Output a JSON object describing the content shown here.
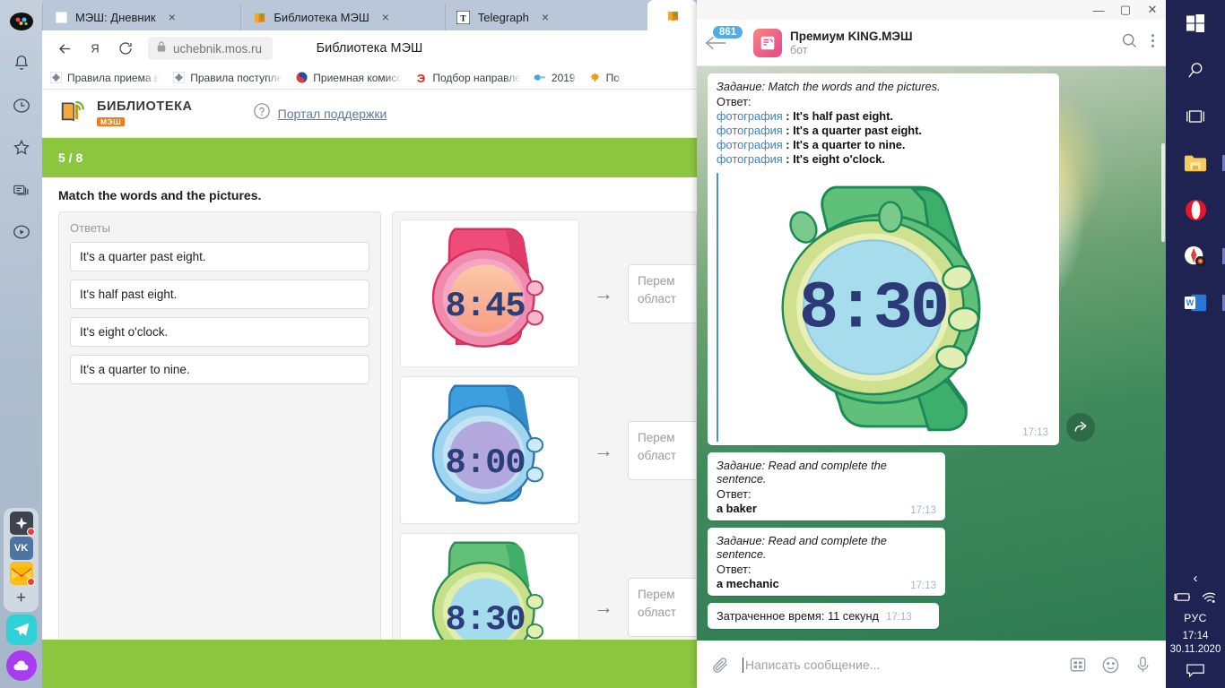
{
  "browser": {
    "tabs": [
      {
        "title": "МЭШ: Дневник",
        "favicon": "blank-page-icon",
        "close": "×"
      },
      {
        "title": "Библиотека МЭШ",
        "favicon": "book-icon",
        "close": "×"
      },
      {
        "title": "Telegraph",
        "favicon": "telegraph-t-icon",
        "close": "×"
      }
    ],
    "nav": {
      "back_icon": "back-arrow-icon",
      "yandex_icon": "yandex-ya-icon",
      "reload_icon": "reload-icon",
      "lock_icon": "lock-icon",
      "url": "uchebnik.mos.ru",
      "page_title": "Библиотека МЭШ"
    },
    "bookmarks": [
      {
        "label": "Правила приема в",
        "favicon": "emblem-icon"
      },
      {
        "label": "Правила поступле",
        "favicon": "emblem-icon"
      },
      {
        "label": "Приемная комисс",
        "favicon": "yinyang-icon"
      },
      {
        "label": "Подбор направле",
        "favicon": "e-letter-icon"
      },
      {
        "label": "2019",
        "favicon": "link-icon"
      },
      {
        "label": "По",
        "favicon": "eagle-icon"
      }
    ]
  },
  "page": {
    "logo": {
      "line1": "БИБЛИОТЕКА",
      "line2": "МЭШ",
      "icon": "open-book-icon"
    },
    "support": {
      "label": "Портал поддержки",
      "icon": "question-mark-icon"
    },
    "progress": "5 / 8",
    "task_title": "Match the words and the pictures.",
    "answers_label": "Ответы",
    "answers": [
      "It's a quarter past eight.",
      "It's half past eight.",
      "It's eight o'clock.",
      "It's a quarter to nine."
    ],
    "pairs": [
      {
        "image": "pink-digital-watch",
        "time_display": "8:45",
        "arrow": "→",
        "drop_text": "Перем\nобласт"
      },
      {
        "image": "blue-digital-watch",
        "time_display": "8:00",
        "arrow": "→",
        "drop_text": "Перем\nобласт"
      },
      {
        "image": "green-digital-watch",
        "time_display": "8:30",
        "arrow": "→",
        "drop_text": "Перем\nобласт"
      }
    ]
  },
  "telegram": {
    "window_controls": {
      "minimize": "—",
      "maximize": "▢",
      "close": "✕"
    },
    "header": {
      "unread_badge": "861",
      "back_icon": "back-arrow-icon",
      "avatar_icon": "king-mesh-bot-avatar",
      "name": "Премиум KING.МЭШ",
      "subtitle": "бот",
      "search_icon": "search-icon",
      "menu_icon": "more-vertical-icon"
    },
    "messages": [
      {
        "question": "Задание: Match the words and the pictures.",
        "answer_label": "Ответ:",
        "lines": [
          {
            "photo": "фотография",
            "sep": " : ",
            "text": "It's half past eight."
          },
          {
            "photo": "фотография",
            "sep": " : ",
            "text": "It's a quarter past eight."
          },
          {
            "photo": "фотография",
            "sep": " : ",
            "text": "It's a quarter to nine."
          },
          {
            "photo": "фотография",
            "sep": " : ",
            "text": "It's eight o'clock."
          }
        ],
        "photo": "green-digital-watch",
        "photo_time_display": "8:30",
        "time": "17:13",
        "forward_icon": "forward-arrow-icon"
      },
      {
        "question": "Задание: Read and complete the sentence.",
        "answer_label": "Ответ:",
        "answer": "a baker",
        "time": "17:13"
      },
      {
        "question": "Задание: Read and complete the sentence.",
        "answer_label": "Ответ:",
        "answer": "a mechanic",
        "time": "17:13"
      },
      {
        "text": "Затраченное время: 11 секунд",
        "time": "17:13"
      }
    ],
    "compose": {
      "attach_icon": "paperclip-icon",
      "placeholder": "Написать сообщение...",
      "keyboard_icon": "bot-keyboard-icon",
      "emoji_icon": "smiley-icon",
      "mic_icon": "microphone-icon"
    }
  },
  "left_dock": {
    "items": [
      {
        "name": "profile-avatar",
        "icon": "avatar-icon"
      },
      {
        "name": "notifications",
        "icon": "bell-icon"
      },
      {
        "name": "history",
        "icon": "clock-icon"
      },
      {
        "name": "bookmarks",
        "icon": "star-icon"
      },
      {
        "name": "collections",
        "icon": "cards-icon"
      },
      {
        "name": "media",
        "icon": "play-circle-icon"
      }
    ],
    "messenger_group": [
      {
        "name": "messenger-app",
        "icon": "diamond-icon",
        "badge": true
      },
      {
        "name": "vk",
        "icon": "vk-icon",
        "badge": false
      },
      {
        "name": "mail",
        "icon": "envelope-icon",
        "badge": true
      },
      {
        "name": "add-service",
        "icon": "plus-icon",
        "badge": false
      }
    ],
    "pinned": [
      {
        "name": "telegram-app",
        "icon": "telegram-icon"
      },
      {
        "name": "cloud-app",
        "icon": "cloud-icon"
      }
    ]
  },
  "taskbar": {
    "items": [
      {
        "name": "start",
        "icon": "windows-logo-icon"
      },
      {
        "name": "search",
        "icon": "search-icon"
      },
      {
        "name": "task-view",
        "icon": "task-view-icon"
      },
      {
        "name": "file-explorer",
        "icon": "folder-icon"
      },
      {
        "name": "opera",
        "icon": "opera-o-icon"
      },
      {
        "name": "yandex-browser",
        "icon": "yandex-browser-icon"
      },
      {
        "name": "word",
        "icon": "word-w-icon"
      }
    ],
    "tray": {
      "chevron": "‹",
      "battery_icon": "battery-charging-icon",
      "wifi_icon": "wifi-icon",
      "language": "РУС",
      "time": "17:14",
      "date": "30.11.2020",
      "notifications_icon": "speech-bubble-icon"
    }
  }
}
